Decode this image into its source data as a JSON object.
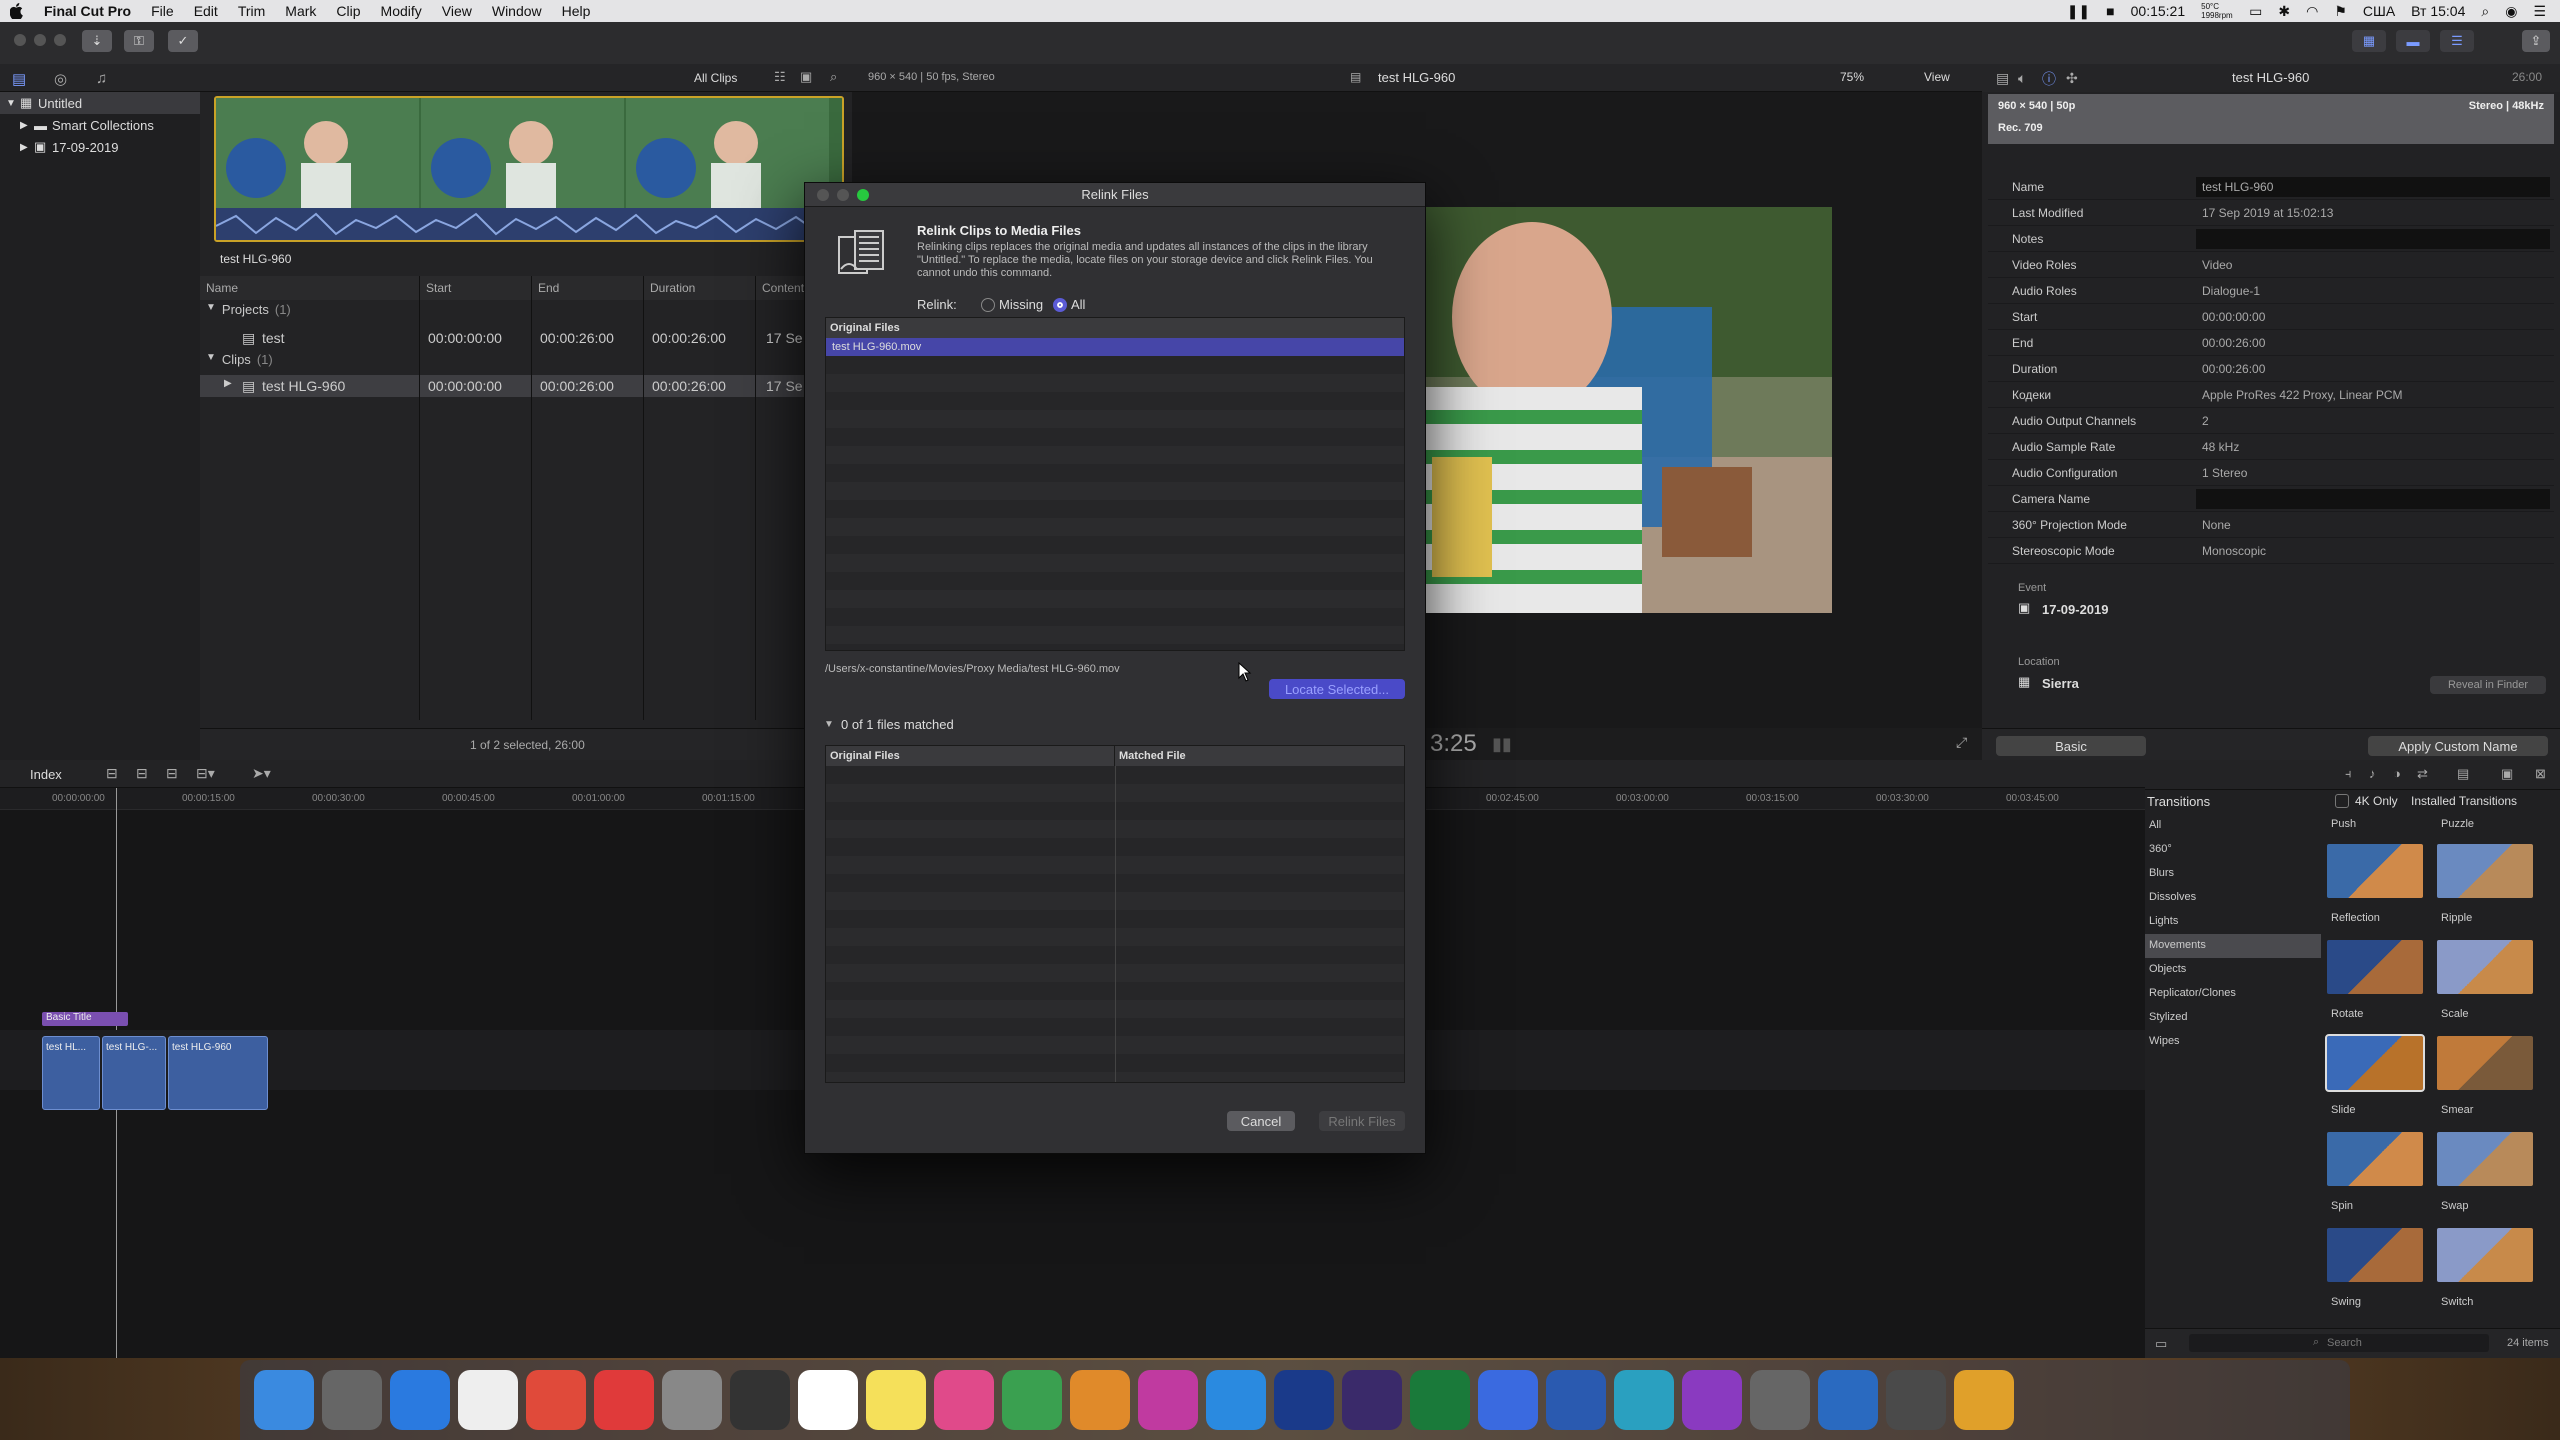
{
  "menubar": {
    "apple": "",
    "app": "Final Cut Pro",
    "items": [
      "File",
      "Edit",
      "Trim",
      "Mark",
      "Clip",
      "Modify",
      "View",
      "Window",
      "Help"
    ],
    "clock": "00:15:21",
    "cpu": "50°C\n1998rpm",
    "country": "США",
    "datetime": "Вт 15:04"
  },
  "library": {
    "root": "Untitled",
    "smart": "Smart Collections",
    "event": "17-09-2019"
  },
  "browser": {
    "filter": "All Clips",
    "format": "960 × 540 | 50 fps, Stereo",
    "filmstrip_label": "test HLG-960",
    "columns": [
      "Name",
      "Start",
      "End",
      "Duration",
      "Content"
    ],
    "projects_group": "Projects",
    "projects_count": "(1)",
    "project_name": "test",
    "project_start": "00:00:00:00",
    "project_end": "00:00:26:00",
    "project_dur": "00:00:26:00",
    "project_content": "17 Se",
    "clips_group": "Clips",
    "clips_count": "(1)",
    "clip_name": "test HLG-960",
    "clip_start": "00:00:00:00",
    "clip_end": "00:00:26:00",
    "clip_dur": "00:00:26:00",
    "clip_content": "17 Se",
    "status": "1 of 2 selected, 26:00"
  },
  "viewer": {
    "title": "test HLG-960",
    "zoom": "75%",
    "view": "View",
    "timecode": "3:25"
  },
  "inspector": {
    "title": "test HLG-960",
    "duration": "26:00",
    "res": "960 × 540 | 50p",
    "audio": "Stereo | 48kHz",
    "colorspace": "Rec. 709",
    "rows": [
      {
        "label": "Name",
        "value": "test HLG-960"
      },
      {
        "label": "Last Modified",
        "value": "17 Sep 2019 at 15:02:13"
      },
      {
        "label": "Notes",
        "value": ""
      },
      {
        "label": "Video Roles",
        "value": "Video"
      },
      {
        "label": "Audio Roles",
        "value": "Dialogue-1"
      },
      {
        "label": "Start",
        "value": "00:00:00:00"
      },
      {
        "label": "End",
        "value": "00:00:26:00"
      },
      {
        "label": "Duration",
        "value": "00:00:26:00"
      },
      {
        "label": "Кодеки",
        "value": "Apple ProRes 422 Proxy, Linear PCM"
      },
      {
        "label": "Audio Output Channels",
        "value": "2"
      },
      {
        "label": "Audio Sample Rate",
        "value": "48 kHz"
      },
      {
        "label": "Audio Configuration",
        "value": "1 Stereo"
      },
      {
        "label": "Camera Name",
        "value": ""
      },
      {
        "label": "360° Projection Mode",
        "value": "None"
      },
      {
        "label": "Stereoscopic Mode",
        "value": "Monoscopic"
      }
    ],
    "event_label": "Event",
    "event_value": "17-09-2019",
    "location_label": "Location",
    "location_value": "Sierra",
    "reveal": "Reveal in Finder",
    "basic": "Basic",
    "apply": "Apply Custom Name"
  },
  "timeline": {
    "index": "Index",
    "ticks": [
      "00:00:00:00",
      "00:00:15:00",
      "00:00:30:00",
      "00:00:45:00",
      "00:01:00:00",
      "00:01:15:00",
      "00:02:45:00",
      "00:03:00:00",
      "00:03:15:00",
      "00:03:30:00",
      "00:03:45:00"
    ],
    "title_clip": "Basic Title",
    "clips": [
      "test HL...",
      "test HLG-...",
      "test HLG-960"
    ]
  },
  "transitions": {
    "header": "Transitions",
    "only4k": "4K Only",
    "installed": "Installed Transitions",
    "categories": [
      "All",
      "360°",
      "Blurs",
      "Dissolves",
      "Lights",
      "Movements",
      "Objects",
      "Replicator/Clones",
      "Stylized",
      "Wipes"
    ],
    "selected": "Movements",
    "items": [
      "Push",
      "Puzzle",
      "Reflection",
      "Ripple",
      "Rotate",
      "Scale",
      "Slide",
      "Smear",
      "Spin",
      "Swap",
      "Swing",
      "Switch"
    ],
    "search": "Search",
    "count": "24 items"
  },
  "dialog": {
    "title": "Relink Files",
    "heading": "Relink Clips to Media Files",
    "description": "Relinking clips replaces the original media and updates all instances of the clips in the library \"Untitled.\" To replace the media, locate files on your storage device and click Relink Files. You cannot undo this command.",
    "relink_label": "Relink:",
    "opt_missing": "Missing",
    "opt_all": "All",
    "original_files": "Original Files",
    "file1": "test HLG-960.mov",
    "path": "/Users/x-constantine/Movies/Proxy Media/test HLG-960.mov",
    "locate": "Locate Selected...",
    "matched_summary": "0 of 1 files matched",
    "col_original": "Original Files",
    "col_matched": "Matched File",
    "cancel": "Cancel",
    "relink": "Relink Files"
  },
  "dock": {
    "items": [
      "Finder",
      "Launchpad",
      "Safari",
      "TextEdit",
      "Chrome",
      "Yandex",
      "Calculator",
      "Final Cut",
      "Calendar",
      "Notes",
      "iTunes",
      "uTorrent",
      "Books",
      "Instagram",
      "App Store",
      "Ps",
      "Ae",
      "X",
      "Files",
      "W",
      "Compressor",
      "Motion",
      "System Preferences",
      "Mail",
      "Migration",
      "Photos"
    ],
    "calendar_month": "СЕНТ.",
    "calendar_day": "17",
    "appstore_badge": "1"
  },
  "colors": {
    "accent": "#5b5bd6",
    "selection": "#3c3c8c",
    "menubar": "#e4e4e6",
    "panel": "#232325"
  }
}
